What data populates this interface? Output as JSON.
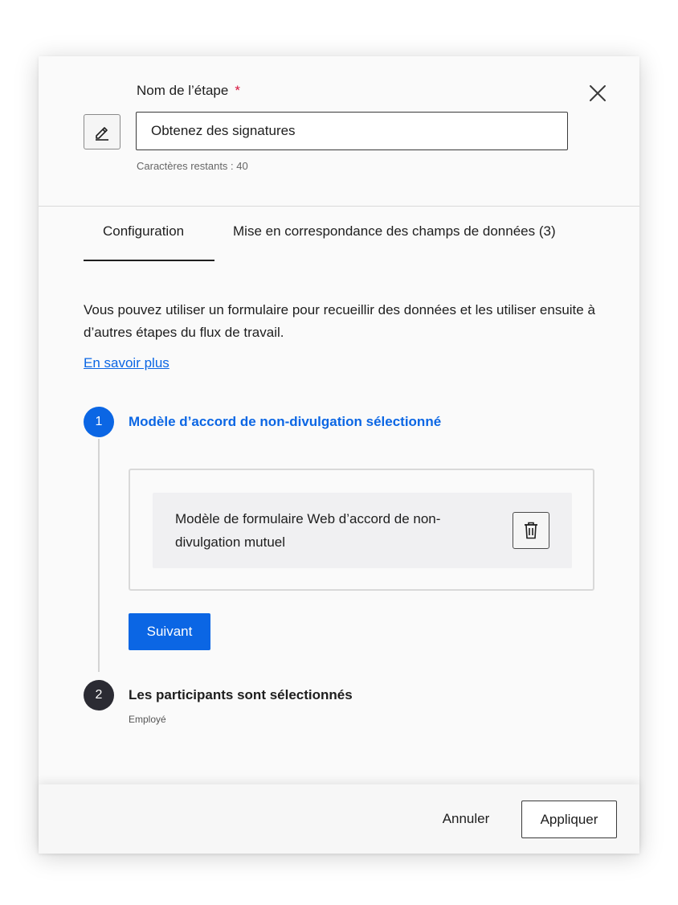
{
  "header": {
    "step_label": "Nom de l’étape",
    "required_marker": "*",
    "step_name_value": "Obtenez des signatures",
    "chars_remaining": "Caractères restants : 40",
    "edit_icon": "pencil-icon",
    "close_icon": "close-icon"
  },
  "tabs": [
    {
      "label": "Configuration",
      "active": true
    },
    {
      "label": "Mise en correspondance des champs de données (3)",
      "active": false
    }
  ],
  "body": {
    "description": "Vous pouvez utiliser un formulaire pour recueillir des données et les utiliser ensuite à d’autres étapes du flux de travail.",
    "learn_more": "En savoir plus"
  },
  "steps": [
    {
      "number": "1",
      "title": "Modèle d’accord de non-divulgation sélectionné",
      "template_name": "Modèle de formulaire Web d’accord de non-divulgation mutuel",
      "delete_icon": "trash-icon",
      "next_label": "Suivant"
    },
    {
      "number": "2",
      "title": "Les participants sont sélectionnés",
      "subtitle": "Employé"
    }
  ],
  "footer": {
    "cancel_label": "Annuler",
    "apply_label": "Appliquer"
  },
  "colors": {
    "accent": "#0b66e4",
    "required": "#d6133c",
    "step_inactive": "#2b2b33"
  }
}
